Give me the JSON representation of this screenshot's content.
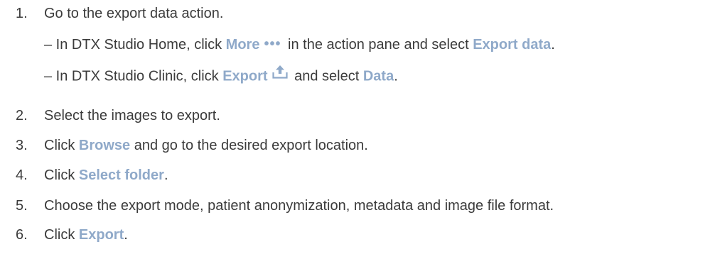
{
  "steps": [
    {
      "num": "1.",
      "text": "Go to the export data action."
    },
    {
      "num": "2.",
      "text": "Select the images to export."
    },
    {
      "num": "3.",
      "pre": "Click ",
      "ui": "Browse",
      "post": " and go to the desired export location."
    },
    {
      "num": "4.",
      "pre": "Click ",
      "ui": "Select folder",
      "post": "."
    },
    {
      "num": "5.",
      "text": "Choose the export mode, patient anonymization, metadata and image file format."
    },
    {
      "num": "6.",
      "pre": "Click ",
      "ui": "Export",
      "post": "."
    }
  ],
  "substeps": [
    {
      "pre": "– In DTX Studio Home, click ",
      "ui1": "More",
      "icon": "more-dots-icon",
      "icon_glyph": "•••",
      "mid": " in the action pane and select ",
      "ui2": "Export data",
      "post": "."
    },
    {
      "pre": "– In DTX Studio Clinic, click ",
      "ui1": "Export",
      "icon": "export-upload-icon",
      "mid": " and select ",
      "ui2": "Data",
      "post": "."
    }
  ],
  "colors": {
    "body_text": "#3b3b3b",
    "ui_label": "#8fa9c9"
  }
}
